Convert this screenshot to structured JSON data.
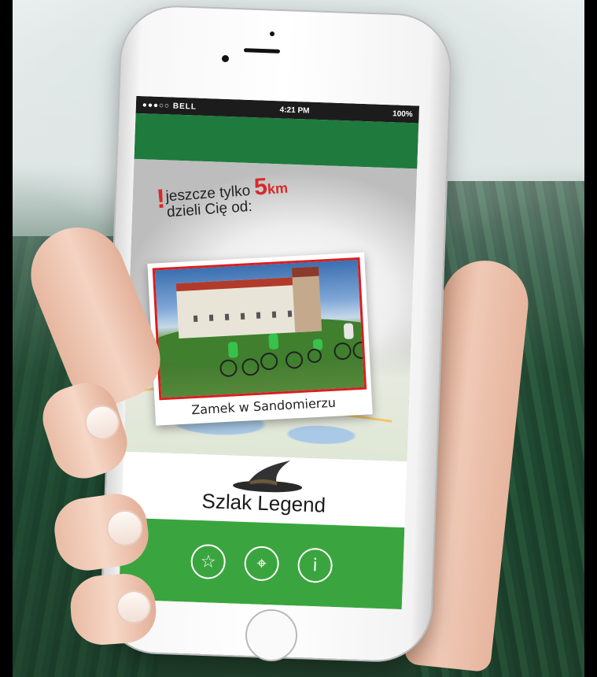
{
  "status": {
    "carrier": "●●●○○ BELL",
    "time": "4:21 PM",
    "battery": "100%"
  },
  "hero": {
    "exclamation": "!",
    "line1_text": "jeszcze tylko",
    "distance_value": "5",
    "distance_unit": "km",
    "line2_text": "dzieli Cię od:",
    "destination": "Zamek w Sandomierzu"
  },
  "brand": {
    "title": "Szlak Legend",
    "hat_icon": "witch-hat-icon"
  },
  "nav": {
    "favorites_icon": "☆",
    "map_icon": "⌖",
    "info_icon": "i"
  },
  "colors": {
    "topbar_green": "#1f7a3e",
    "nav_green": "#3aa53f",
    "accent_red": "#d62a2a"
  }
}
